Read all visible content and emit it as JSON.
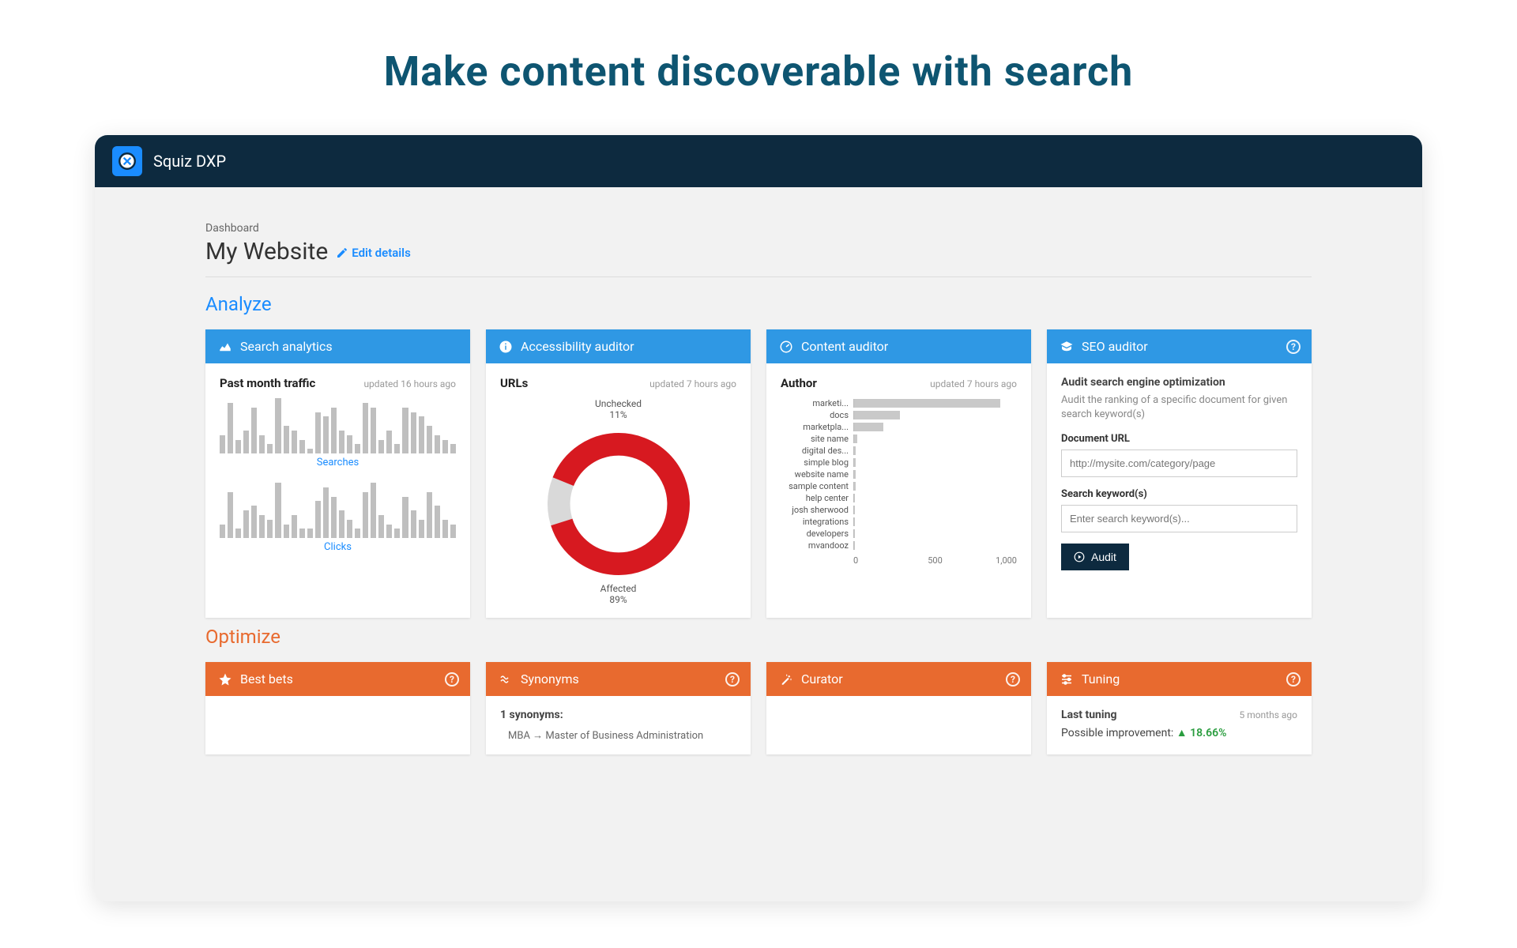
{
  "hero": "Make content discoverable with search",
  "app_name": "Squiz DXP",
  "breadcrumb": "Dashboard",
  "page_title": "My Website",
  "edit_label": "Edit details",
  "sections": {
    "analyze": "Analyze",
    "optimize": "Optimize"
  },
  "analyze": {
    "search_analytics": {
      "title": "Search analytics",
      "subtitle": "Past month traffic",
      "updated": "updated 16 hours ago",
      "chart1_label": "Searches",
      "chart2_label": "Clicks"
    },
    "accessibility": {
      "title": "Accessibility auditor",
      "subtitle": "URLs",
      "updated": "updated 7 hours ago",
      "unchecked_label": "Unchecked",
      "unchecked_pct": "11%",
      "affected_label": "Affected",
      "affected_pct": "89%"
    },
    "content_auditor": {
      "title": "Content auditor",
      "subtitle": "Author",
      "updated": "updated 7 hours ago"
    },
    "seo": {
      "title": "SEO auditor",
      "heading": "Audit search engine optimization",
      "desc": "Audit the ranking of a specific document for given search keyword(s)",
      "url_label": "Document URL",
      "url_placeholder": "http://mysite.com/category/page",
      "kw_label": "Search keyword(s)",
      "kw_placeholder": "Enter search keyword(s)...",
      "audit_btn": "Audit"
    }
  },
  "optimize": {
    "best_bets": {
      "title": "Best bets"
    },
    "synonyms": {
      "title": "Synonyms",
      "count_label": "1 synonyms:",
      "item": "MBA → Master of Business Administration"
    },
    "curator": {
      "title": "Curator"
    },
    "tuning": {
      "title": "Tuning",
      "last_label": "Last tuning",
      "last_time": "5 months ago",
      "improvement_label": "Possible improvement:",
      "improvement_value": "18.66%"
    }
  },
  "chart_data": [
    {
      "type": "bar",
      "title": "Past month traffic — Searches",
      "note": "approximate relative heights, unlabeled axis",
      "values": [
        20,
        55,
        15,
        25,
        50,
        20,
        10,
        60,
        30,
        25,
        15,
        5,
        45,
        40,
        50,
        25,
        20,
        10,
        55,
        50,
        15,
        25,
        10,
        50,
        45,
        40,
        30,
        20,
        15,
        10
      ]
    },
    {
      "type": "bar",
      "title": "Past month traffic — Clicks",
      "note": "approximate relative heights, unlabeled axis",
      "values": [
        15,
        50,
        10,
        30,
        35,
        25,
        20,
        60,
        15,
        25,
        10,
        10,
        40,
        55,
        45,
        30,
        20,
        10,
        50,
        60,
        25,
        15,
        10,
        45,
        30,
        20,
        50,
        35,
        20,
        15
      ]
    },
    {
      "type": "pie",
      "title": "Accessibility auditor — URLs",
      "series": [
        {
          "name": "Unchecked",
          "value": 11,
          "color": "#d9d9d9"
        },
        {
          "name": "Affected",
          "value": 89,
          "color": "#d71920"
        }
      ]
    },
    {
      "type": "bar",
      "orientation": "horizontal",
      "title": "Content auditor — Author",
      "xlabel": "",
      "xlim": [
        0,
        1000
      ],
      "categories": [
        "marketi...",
        "docs",
        "marketpla...",
        "site name",
        "digital des...",
        "simple blog",
        "website name",
        "sample content",
        "help center",
        "josh sherwood",
        "integrations",
        "developers",
        "mvandooz"
      ],
      "values": [
        900,
        280,
        180,
        20,
        10,
        10,
        10,
        10,
        5,
        5,
        5,
        5,
        5
      ],
      "ticks": [
        0,
        500,
        1000
      ]
    }
  ]
}
